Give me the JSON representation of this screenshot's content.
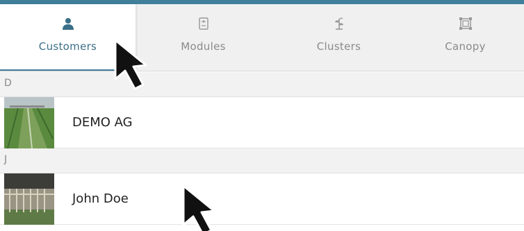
{
  "colors": {
    "accent": "#3f7f9a",
    "tab_bg": "#f0f0f0",
    "section_bg": "#f2f2f2"
  },
  "tabs": [
    {
      "label": "Customers",
      "icon": "person-icon",
      "active": true
    },
    {
      "label": "Modules",
      "icon": "module-icon",
      "active": false
    },
    {
      "label": "Clusters",
      "icon": "cluster-plant-icon",
      "active": false
    },
    {
      "label": "Canopy",
      "icon": "canopy-frame-icon",
      "active": false
    }
  ],
  "sections": [
    {
      "letter": "D",
      "customers": [
        {
          "name": "DEMO AG",
          "thumbnail": "field-irrigation-photo"
        }
      ]
    },
    {
      "letter": "J",
      "customers": [
        {
          "name": "John Doe",
          "thumbnail": "field-fence-photo"
        }
      ]
    }
  ]
}
